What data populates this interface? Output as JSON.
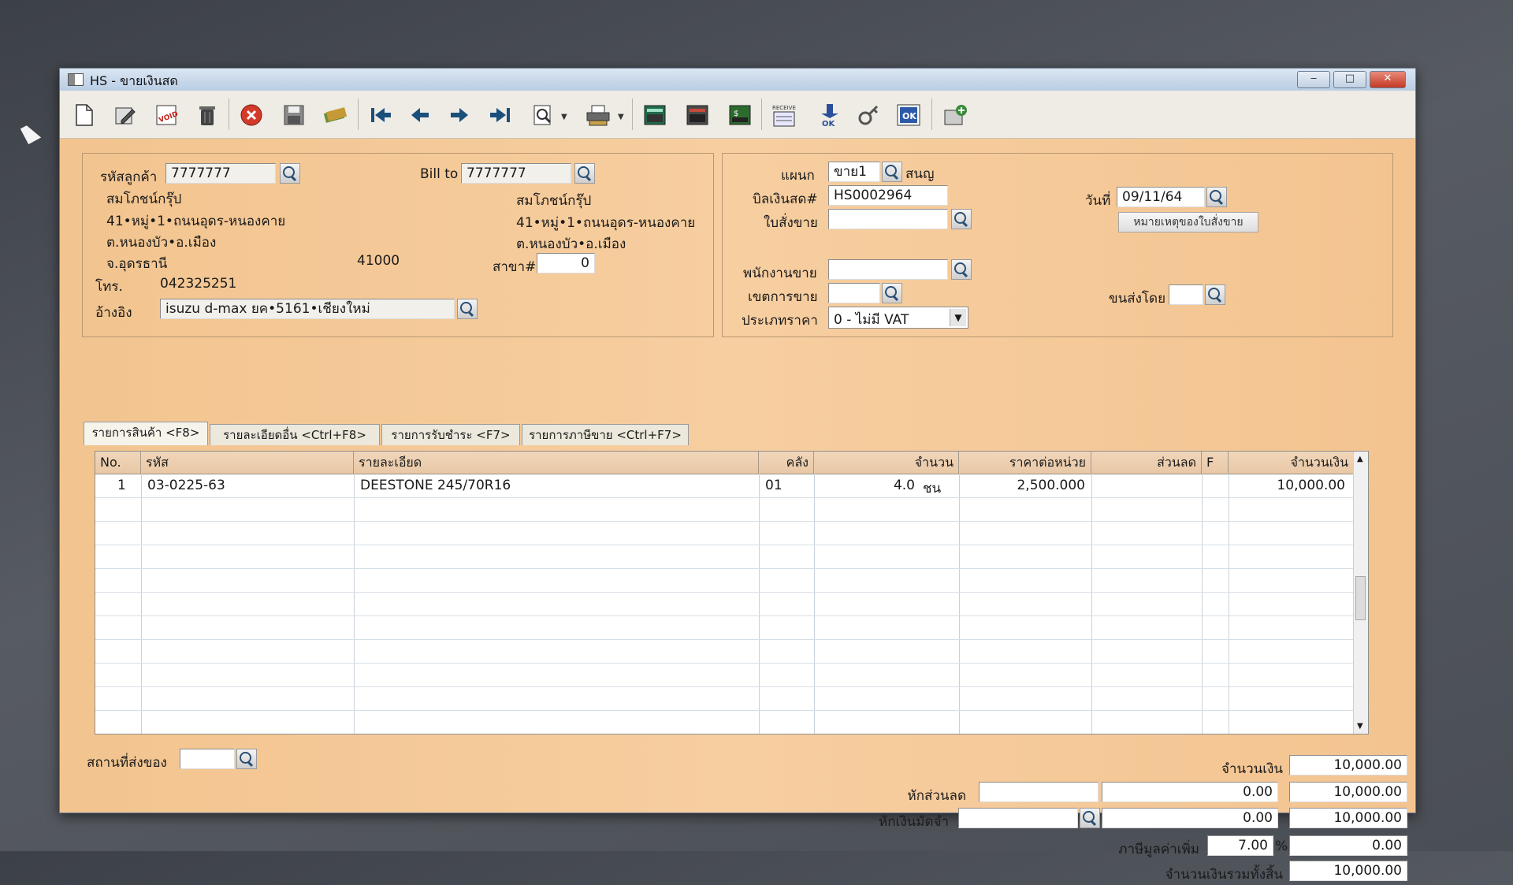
{
  "window": {
    "title": "HS - ขายเงินสด",
    "controls": {
      "minimize": "‒",
      "maximize": "□",
      "close": "✕"
    }
  },
  "toolbar": {
    "icons": [
      "new-doc-icon",
      "edit-icon",
      "void-icon",
      "delete-bin-icon",
      "cancel-icon",
      "save-disk-icon",
      "refresh-icon",
      "first-record-icon",
      "previous-record-icon",
      "next-record-icon",
      "last-record-icon",
      "find-icon",
      "print-icon",
      "screen-a-icon",
      "screen-b-icon",
      "screen-c-icon",
      "report-icon",
      "approve-ok-icon",
      "key-icon",
      "ok-check-icon",
      "settings-icon"
    ],
    "void_label": "VOID",
    "ok_label": "OK",
    "ok2_label": "OK",
    "receipt_label": "RECEIVE"
  },
  "customer": {
    "code_label": "รหัสลูกค้า",
    "code": "7777777",
    "name": "สมโภชน์กรุ๊ป",
    "addr1": "41•หมู่•1•ถนนอุดร-หนองคาย",
    "addr2": "ต.หนองบัว•อ.เมือง",
    "province": "จ.อุดรธานี",
    "postcode": "41000",
    "phone_label": "โทร.",
    "phone": "042325251",
    "ref_label": "อ้างอิง",
    "ref": "isuzu d-max ยค•5161•เชียงใหม่"
  },
  "billto": {
    "label": "Bill to",
    "code": "7777777",
    "name": "สมโภชน์กรุ๊ป",
    "addr1": "41•หมู่•1•ถนนอุดร-หนองคาย",
    "addr2": "ต.หนองบัว•อ.เมือง",
    "branch_label": "สาขา#",
    "branch": "0"
  },
  "doc": {
    "dept_label": "แผนก",
    "dept": "ขาย1",
    "dept_name": "สนญ",
    "bill_label": "บิลเงินสด#",
    "bill_no": "HS0002964",
    "date_label": "วันที่",
    "date": "09/11/64",
    "so_label": "ใบสั่งขาย",
    "so_value": "",
    "so_note_button": "หมายเหตุของใบสั่งขาย",
    "sales_label": "พนักงานขาย",
    "area_label": "เขตการขาย",
    "ship_label": "ขนส่งโดย",
    "price_type_label": "ประเภทราคา",
    "price_type": "0 - ไม่มี VAT"
  },
  "tabs": [
    "รายการสินค้า <F8>",
    "รายละเอียดอื่น <Ctrl+F8>",
    "รายการรับชำระ <F7>",
    "รายการภาษีขาย <Ctrl+F7>"
  ],
  "grid": {
    "headers": [
      "No.",
      "รหัส",
      "รายละเอียด",
      "คลัง",
      "จำนวน",
      "ราคาต่อหน่วย",
      "ส่วนลด",
      "F",
      "จำนวนเงิน"
    ],
    "rows": [
      {
        "no": "1",
        "code": "03-0225-63",
        "desc": "DEESTONE 245/70R16",
        "wh": "01",
        "qty": "4.0",
        "unit": "ชน",
        "price": "2,500.000",
        "discount": "",
        "f": "",
        "amount": "10,000.00"
      }
    ]
  },
  "footer": {
    "ship_place_label": "สถานที่ส่งของ",
    "amount_label": "จำนวนเงิน",
    "amount": "10,000.00",
    "discount_label": "หักส่วนลด",
    "discount_value": "0.00",
    "after_discount": "10,000.00",
    "deposit_label": "หักเงินมัดจำ",
    "deposit_value": "0.00",
    "after_deposit": "10,000.00",
    "vat_label": "ภาษีมูลค่าเพิ่ม",
    "vat_rate": "7.00",
    "vat_pct": "%",
    "vat_amount": "0.00",
    "total_label": "จำนวนเงินรวมทั้งสิ้น",
    "total": "10,000.00"
  }
}
